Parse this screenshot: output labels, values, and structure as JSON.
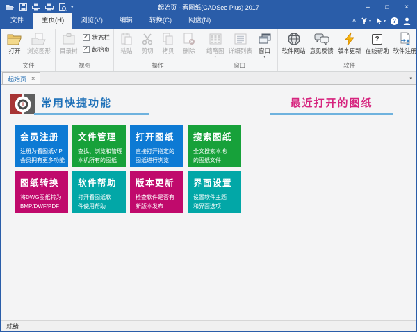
{
  "window": {
    "title": "起始页 - 看图纸(CADSee Plus) 2017"
  },
  "glyphs": {
    "caret_down": "▾",
    "ribbon_collapse": "^",
    "minimize": "–",
    "maximize": "□",
    "close": "×",
    "help": "?",
    "check": "✓",
    "plus": "+"
  },
  "quick_access": {
    "icons": [
      "open-file-icon",
      "save-icon",
      "print-icon",
      "quick-print-icon",
      "print-preview-icon",
      "customize-dropdown"
    ]
  },
  "menu": {
    "tabs": [
      {
        "label": "文件"
      },
      {
        "label": "主页(H)",
        "active": true
      },
      {
        "label": "浏览(V)"
      },
      {
        "label": "编辑"
      },
      {
        "label": "转换(C)"
      },
      {
        "label": "网盘(N)"
      }
    ],
    "right_icons": [
      "collapse-ribbon",
      "tools-wrench",
      "pointer-tool",
      "help",
      "user-account"
    ]
  },
  "ribbon": {
    "groups": [
      {
        "label": "文件",
        "items": [
          {
            "label": "打开",
            "icon": "folder-open",
            "disabled": false
          },
          {
            "label": "浏览图形",
            "icon": "browse-drawings",
            "disabled": true
          }
        ]
      },
      {
        "label": "视图",
        "items": [
          {
            "label": "目录树",
            "icon": "directory-tree",
            "disabled": true
          }
        ],
        "checkboxes": [
          {
            "label": "状态栏",
            "checked": true
          },
          {
            "label": "起始页",
            "checked": true
          }
        ]
      },
      {
        "label": "操作",
        "items": [
          {
            "label": "粘贴",
            "icon": "paste",
            "disabled": true
          },
          {
            "label": "剪切",
            "icon": "cut",
            "disabled": true
          },
          {
            "label": "拷贝",
            "icon": "copy",
            "disabled": true
          },
          {
            "label": "删除",
            "icon": "delete",
            "disabled": true
          }
        ]
      },
      {
        "label": "窗口",
        "items": [
          {
            "label": "缩略图",
            "icon": "thumbnails",
            "disabled": true,
            "dropdown": true
          },
          {
            "label": "详细列表",
            "icon": "detail-list",
            "disabled": true
          },
          {
            "label": "窗口",
            "icon": "windows",
            "disabled": false,
            "dropdown": true
          }
        ]
      },
      {
        "label": "软件",
        "items": [
          {
            "label": "软件网站",
            "icon": "website-globe",
            "disabled": false
          },
          {
            "label": "意见反馈",
            "icon": "feedback-chat",
            "disabled": false
          },
          {
            "label": "版本更新",
            "icon": "update-bolt",
            "disabled": false
          },
          {
            "label": "在线帮助",
            "icon": "online-help",
            "disabled": false
          },
          {
            "label": "软件注册",
            "icon": "register-doc",
            "disabled": false
          }
        ]
      }
    ]
  },
  "doc_tabs": [
    {
      "label": "起始页"
    }
  ],
  "start_page": {
    "left_title": "常用快捷功能",
    "right_title": "最近打开的图纸",
    "tiles": [
      {
        "title": "会员注册",
        "desc1": "注册为看图纸VIP",
        "desc2": "会员拥有更多功能",
        "color": "#0d7ad4"
      },
      {
        "title": "文件管理",
        "desc1": "查找、浏览和管理",
        "desc2": "本机所有的图纸",
        "color": "#17a13a"
      },
      {
        "title": "打开图纸",
        "desc1": "直接打开指定的",
        "desc2": "图纸进行浏览",
        "color": "#0d7ad4"
      },
      {
        "title": "搜索图纸",
        "desc1": "全文搜索本地",
        "desc2": "的图纸文件",
        "color": "#17a13a"
      },
      {
        "title": "图纸转换",
        "desc1": "将DWG图纸转为",
        "desc2": "BMP/DWF/PDF",
        "color": "#c00a6c"
      },
      {
        "title": "软件帮助",
        "desc1": "打开看图纸软",
        "desc2": "件使用帮助",
        "color": "#02a7a7"
      },
      {
        "title": "版本更新",
        "desc1": "检查软件是否有",
        "desc2": "新版本发布",
        "color": "#c00a6c"
      },
      {
        "title": "界面设置",
        "desc1": "设置软件主题",
        "desc2": "和界面选项",
        "color": "#02a7a7"
      }
    ]
  },
  "status_bar": {
    "text": "就绪"
  },
  "colors": {
    "titlebar": "#2a5da9",
    "ribbon_bg": "#f5f6f7",
    "left_title": "#1c6fb8",
    "right_title": "#d6247e",
    "underline": "#6fb2de",
    "tile_blue": "#0d7ad4",
    "tile_green": "#17a13a",
    "tile_magenta": "#c00a6c",
    "tile_teal": "#02a7a7"
  }
}
